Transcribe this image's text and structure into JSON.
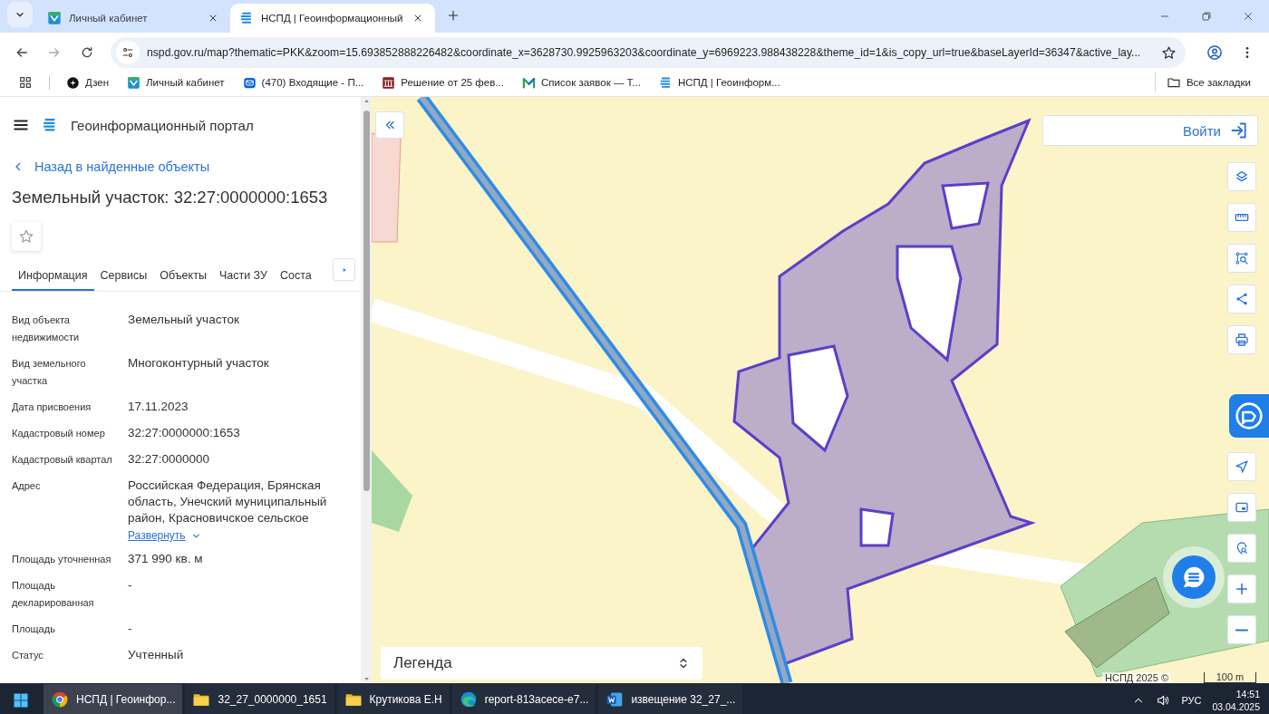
{
  "browser": {
    "tabs": [
      {
        "title": "Личный кабинет",
        "kind": "gosuslugi",
        "selected": false
      },
      {
        "title": "НСПД | Геоинформационный",
        "kind": "nspd",
        "selected": true
      }
    ],
    "address": "nspd.gov.ru/map?thematic=PKK&zoom=15.693852888226482&coordinate_x=3628730.9925963203&coordinate_y=6969223.988438228&theme_id=1&is_copy_url=true&baseLayerId=36347&active_lay...",
    "bookmarks": [
      {
        "label": "Дзен",
        "kind": "dzen"
      },
      {
        "label": "Личный кабинет",
        "kind": "gosuslugi"
      },
      {
        "label": "(470) Входящие - П...",
        "kind": "mail"
      },
      {
        "label": "Решение от 25 фев...",
        "kind": "court"
      },
      {
        "label": "Список заявок — Т...",
        "kind": "zigzag"
      },
      {
        "label": "НСПД | Геоинформ...",
        "kind": "nspd"
      }
    ],
    "all_bookmarks": "Все закладки"
  },
  "portal": {
    "title": "Геоинформационный портал",
    "back": "Назад в найденные объекты",
    "heading": "Земельный участок: 32:27:0000000:1653",
    "favorite": false,
    "tabs": [
      {
        "label": "Информация",
        "selected": true
      },
      {
        "label": "Сервисы",
        "selected": false
      },
      {
        "label": "Объекты",
        "selected": false
      },
      {
        "label": "Части ЗУ",
        "selected": false
      },
      {
        "label": "Соста",
        "selected": false
      }
    ],
    "fields": [
      {
        "label": "Вид объекта недвижимости",
        "value": "Земельный участок"
      },
      {
        "label": "Вид земельного участка",
        "value": "Многоконтурный участок"
      },
      {
        "label": "Дата присвоения",
        "value": "17.11.2023"
      },
      {
        "label": "Кадастровый номер",
        "value": "32:27:0000000:1653"
      },
      {
        "label": "Кадастровый квартал",
        "value": "32:27:0000000"
      },
      {
        "label": "Адрес",
        "value": "Российская Федерация, Брянская область, Унечский муниципальный район, Красновичское сельское",
        "link": "Развернуть"
      },
      {
        "label": "Площадь уточненная",
        "value": "371 990 кв. м"
      },
      {
        "label": "Площадь декларированная",
        "value": "-"
      },
      {
        "label": "Площадь",
        "value": "-"
      },
      {
        "label": "Статус",
        "value": "Учтенный"
      }
    ]
  },
  "map": {
    "login": "Войти",
    "legend": "Легенда",
    "attribution": "НСПД 2025 ©",
    "scale": "100 m"
  },
  "taskbar": {
    "items": [
      {
        "label": "НСПД | Геоинфор...",
        "kind": "chrome",
        "selected": true
      },
      {
        "label": "32_27_0000000_1651",
        "kind": "folder",
        "selected": false
      },
      {
        "label": "Крутикова Е.Н",
        "kind": "folder",
        "selected": false
      },
      {
        "label": "report-813acece-e7...",
        "kind": "edge",
        "selected": false
      },
      {
        "label": "извещение 32_27_...",
        "kind": "word",
        "selected": false
      }
    ],
    "language": "РУС",
    "time": "14:51",
    "date": "03.04.2025"
  }
}
